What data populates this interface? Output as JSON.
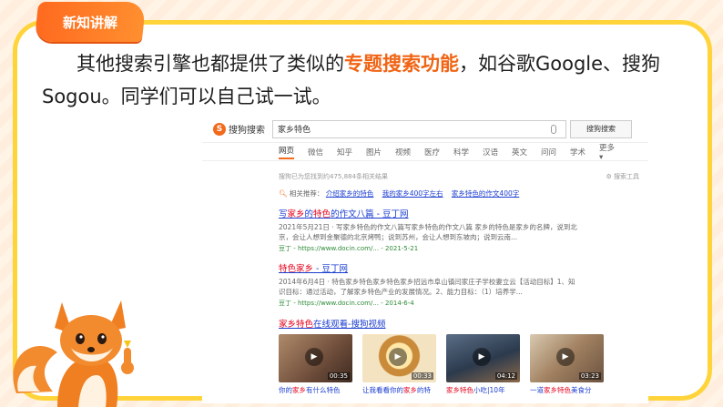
{
  "header": {
    "tag_label": "新知讲解"
  },
  "intro": {
    "part1": "其他搜索引擎也都提供了类似的",
    "highlight": "专题搜索功能",
    "part2": "，如谷歌Google、搜狗Sogou。同学们可以自己试一试。"
  },
  "sogou": {
    "logo_label": "搜狗搜索",
    "search_value": "家乡特色",
    "search_button": "搜狗搜索",
    "tabs": [
      "网页",
      "微信",
      "知乎",
      "图片",
      "视频",
      "医疗",
      "科学",
      "汉语",
      "英文",
      "问问",
      "学术",
      "更多"
    ],
    "result_count": "搜狗已为您找到约475,884条相关结果",
    "search_tools": "搜索工具",
    "related_label": "相关推荐：",
    "related": [
      "介绍家乡的特色",
      "我的家乡400字左右",
      "家乡特色的作文400字"
    ],
    "results": [
      {
        "title_pre": "写",
        "title_hl": "家乡",
        "title_mid": "的",
        "title_hl2": "特色",
        "title_post": "的作文八篇 - 豆丁网",
        "desc": "2021年5月21日 · 写家乡特色的作文八篇写家乡特色的作文八篇 家乡的特色是家乡的名牌，说到北京，会让人想到金聚德的北京烤鸭；说到苏州，会让人想到东坡肉；说到云南...",
        "url": "豆丁 - https://www.docin.com/... - 2021-5-21"
      },
      {
        "title_pre": "",
        "title_hl": "特色家乡",
        "title_mid": "",
        "title_hl2": "",
        "title_post": " - 豆丁网",
        "desc": "2014年6月4日 · 特色家乡特色家乡特色家乡招远市阜山镇闫家庄子学校妻立云【活动目标】1、知识目标：通过活动，了解家乡特色产业的发展情况。2、能力目标：（1）培养学...",
        "url": "豆丁 - https://www.docin.com/... - 2014-6-4"
      }
    ],
    "video_section": {
      "hl": "家乡特色",
      "post": "在线观看-搜狗视频"
    },
    "videos": [
      {
        "dur": "00:35",
        "cap_pre": "你的",
        "cap_hl": "家乡",
        "cap_post": "有什么特色"
      },
      {
        "dur": "00:33",
        "cap_pre": "让我看看你的",
        "cap_hl": "家乡",
        "cap_post": "的特"
      },
      {
        "dur": "04:12",
        "cap_pre": "",
        "cap_hl": "家乡特色",
        "cap_post": "小吃|10年"
      },
      {
        "dur": "03:23",
        "cap_pre": "一道",
        "cap_hl": "家乡特色",
        "cap_post": "美食分"
      }
    ]
  },
  "colors": {
    "accent": "#f06414",
    "frame": "#ffd43b",
    "link": "#1a3ccf",
    "hl_red": "#e4001b"
  }
}
